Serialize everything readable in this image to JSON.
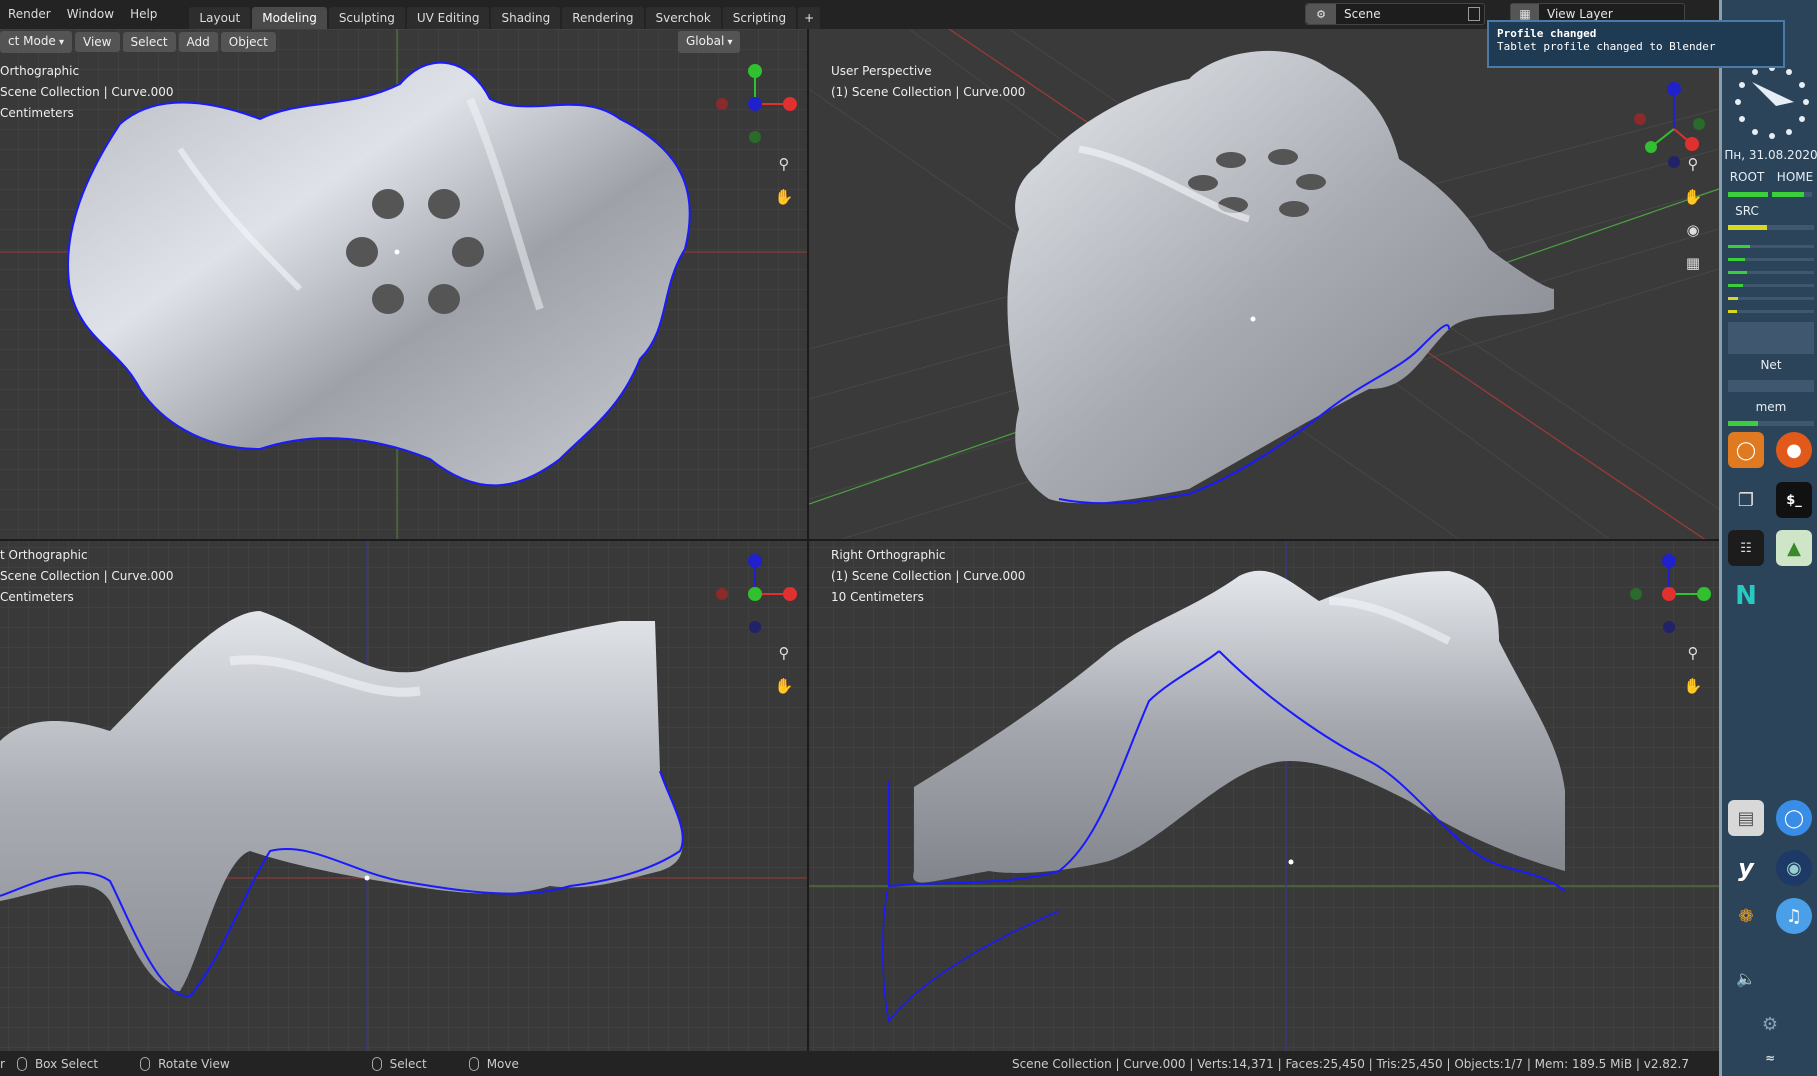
{
  "menu": [
    "Render",
    "Window",
    "Help"
  ],
  "workspace_tabs": [
    {
      "label": "Layout",
      "active": false
    },
    {
      "label": "Modeling",
      "active": true
    },
    {
      "label": "Sculpting",
      "active": false
    },
    {
      "label": "UV Editing",
      "active": false
    },
    {
      "label": "Shading",
      "active": false
    },
    {
      "label": "Rendering",
      "active": false
    },
    {
      "label": "Sverchok",
      "active": false
    },
    {
      "label": "Scripting",
      "active": false
    }
  ],
  "workspace_add": "+",
  "scene": {
    "value": "Scene"
  },
  "view_layer": {
    "value": "View Layer"
  },
  "notification": {
    "title": "Profile changed",
    "body": "Tablet profile changed to Blender"
  },
  "header": {
    "mode": "ct Mode",
    "view": "View",
    "select": "Select",
    "add": "Add",
    "object": "Object",
    "transform": "Global"
  },
  "viewports": [
    {
      "name": "Orthographic",
      "collection": "Scene Collection | Curve.000",
      "scale": "Centimeters"
    },
    {
      "name": "User Perspective",
      "collection": "(1) Scene Collection | Curve.000",
      "scale": ""
    },
    {
      "name": "t Orthographic",
      "collection": "Scene Collection | Curve.000",
      "scale": "Centimeters"
    },
    {
      "name": "Right Orthographic",
      "collection": "(1) Scene Collection | Curve.000",
      "scale": "10 Centimeters"
    }
  ],
  "status": {
    "left_cut": "r",
    "box_select": "Box Select",
    "rotate_view": "Rotate View",
    "select": "Select",
    "move": "Move",
    "info": "Scene Collection | Curve.000 | Verts:14,371 | Faces:25,450 | Tris:25,450 | Objects:1/7 | Mem: 189.5 MiB | v2.82.7"
  },
  "system": {
    "date": "Пн, 31.08.2020",
    "root": "ROOT",
    "home": "HOME",
    "src": "SRC",
    "net": "Net",
    "mem": "mem"
  },
  "colors": {
    "accent_blue": "#1a1aff",
    "axis_red": "#e03030",
    "axis_green": "#30c030",
    "axis_blue": "#2020cc",
    "panel_bg": "#2b4459"
  },
  "icons": [
    "zoom-icon",
    "hand-icon",
    "camera-icon",
    "grid-icon",
    "blender-icon",
    "firefox-icon",
    "terminal-icon",
    "chrome-icon"
  ]
}
